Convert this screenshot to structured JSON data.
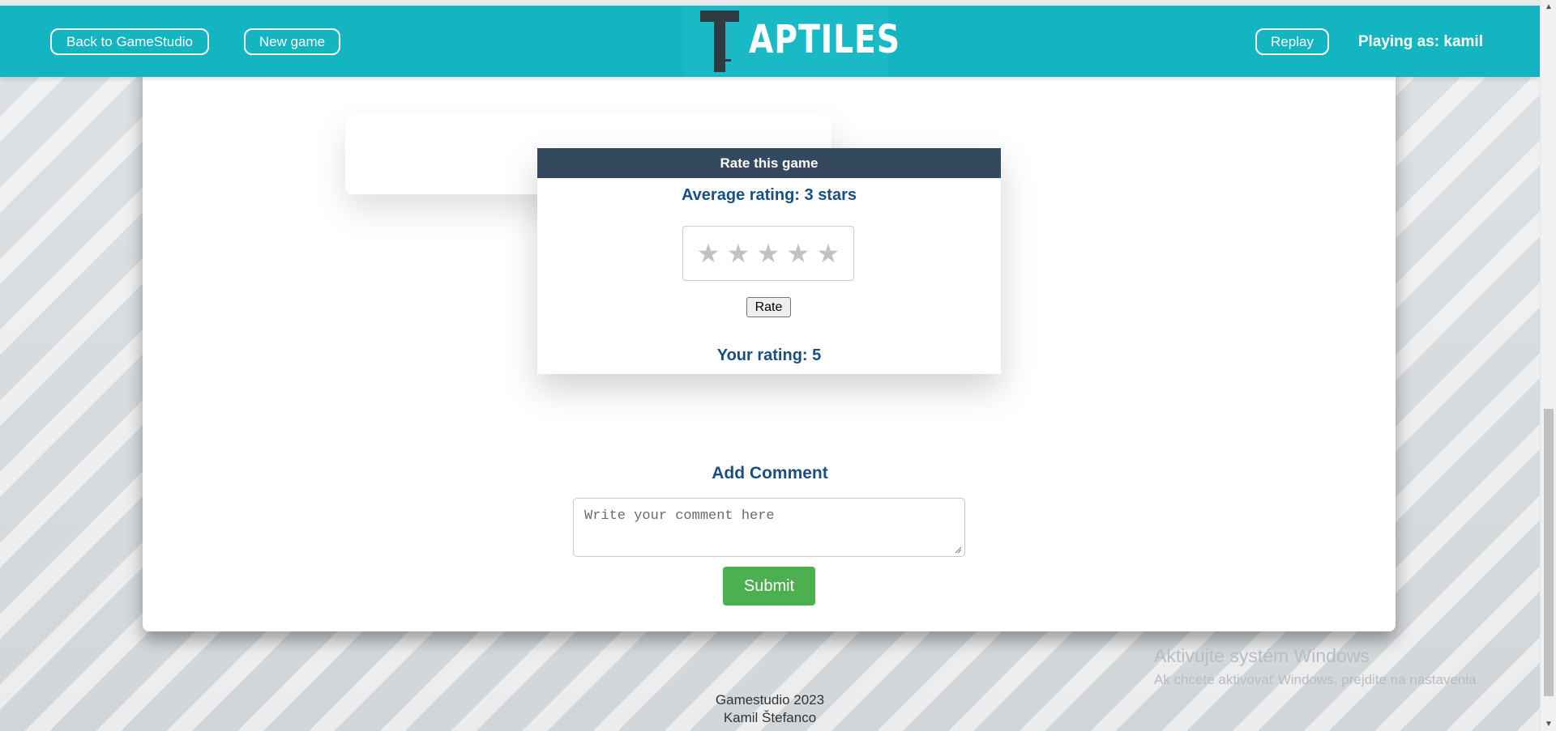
{
  "nav": {
    "back_label": "Back to GameStudio",
    "new_game_label": "New game",
    "logo_text": "APTILES",
    "replay_label": "Replay",
    "player_text": "Playing as: kamil"
  },
  "rating": {
    "header": "Rate this game",
    "average_text": "Average rating: 3 stars",
    "stars": [
      "★",
      "★",
      "★",
      "★",
      "★"
    ],
    "rate_label": "Rate",
    "your_rating_text": "Your rating: 5"
  },
  "comment": {
    "title": "Add Comment",
    "placeholder": "Write your comment here",
    "submit_label": "Submit"
  },
  "windows_watermark": {
    "title": "Aktivujte systém Windows",
    "subtitle": "Ak chcete aktivovať Windows, prejdite na nastavenia."
  },
  "footer": {
    "line1": "Gamestudio 2023",
    "line2": "Kamil Štefanco"
  },
  "colors": {
    "navbar": "#13b5c1",
    "rate_header": "#34495e",
    "heading_text": "#1b4f84",
    "submit": "#4caf50"
  }
}
